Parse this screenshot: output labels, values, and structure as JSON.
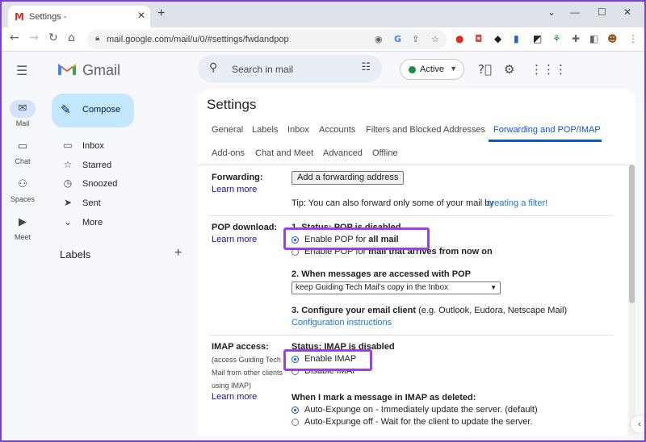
{
  "browser": {
    "tab_title": "Settings -",
    "tab_favicon": "M",
    "new_tab": "+",
    "url": "mail.google.com/mail/u/0/#settings/fwdandpop"
  },
  "gmail": {
    "brand": "Gmail",
    "search_placeholder": "Search in mail",
    "status": "Active",
    "compose": "Compose",
    "rail": [
      "Mail",
      "Chat",
      "Spaces",
      "Meet"
    ],
    "nav": [
      "Inbox",
      "Starred",
      "Snoozed",
      "Sent",
      "More"
    ],
    "labels_heading": "Labels"
  },
  "settings": {
    "title": "Settings",
    "tabs": [
      "General",
      "Labels",
      "Inbox",
      "Accounts",
      "Filters and Blocked Addresses",
      "Forwarding and POP/IMAP",
      "Add-ons",
      "Chat and Meet",
      "Advanced",
      "Offline"
    ],
    "active_tab": "Forwarding and POP/IMAP",
    "learn_more": "Learn more",
    "forwarding": {
      "label": "Forwarding:",
      "button": "Add a forwarding address",
      "tip": "Tip: You can also forward only some of your mail by",
      "tip_link": "creating a filter!"
    },
    "pop": {
      "label": "POP download:",
      "status": "1. Status: POP is disabled",
      "opt1_prefix": "Enable POP for",
      "opt1_bold": "all mail",
      "opt2_prefix": "Enable POP for",
      "opt2_bold": "mail that arrives from now on",
      "q2": "2. When messages are accessed with POP",
      "select_value": "keep Guiding Tech Mail's copy in the Inbox",
      "q3_bold": "3. Configure your email client",
      "q3_rest": "(e.g. Outlook, Eudora, Netscape Mail)",
      "config_link": "Configuration instructions"
    },
    "imap": {
      "label": "IMAP access:",
      "sub": "(access Guiding Tech Mail from other clients using IMAP)",
      "status": "Status: IMAP is disabled",
      "enable": "Enable IMAP",
      "disable": "Disable IMAP",
      "mark_heading": "When I mark a message in IMAP as deleted:",
      "expunge_on": "Auto-Expunge on - Immediately update the server. (default)",
      "expunge_off": "Auto-Expunge off - Wait for the client to update the server."
    }
  },
  "colors": {
    "highlight": "#9c3fe6",
    "accent": "#0b57d0",
    "link": "#1a0dab"
  }
}
